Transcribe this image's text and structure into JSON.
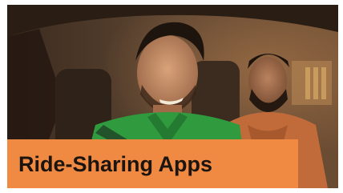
{
  "card": {
    "title": "Ride-Sharing Apps",
    "image_subject": "driver-and-passenger-in-car-photo"
  },
  "colors": {
    "label_background": "#f08a43",
    "label_text": "#1c140e"
  }
}
